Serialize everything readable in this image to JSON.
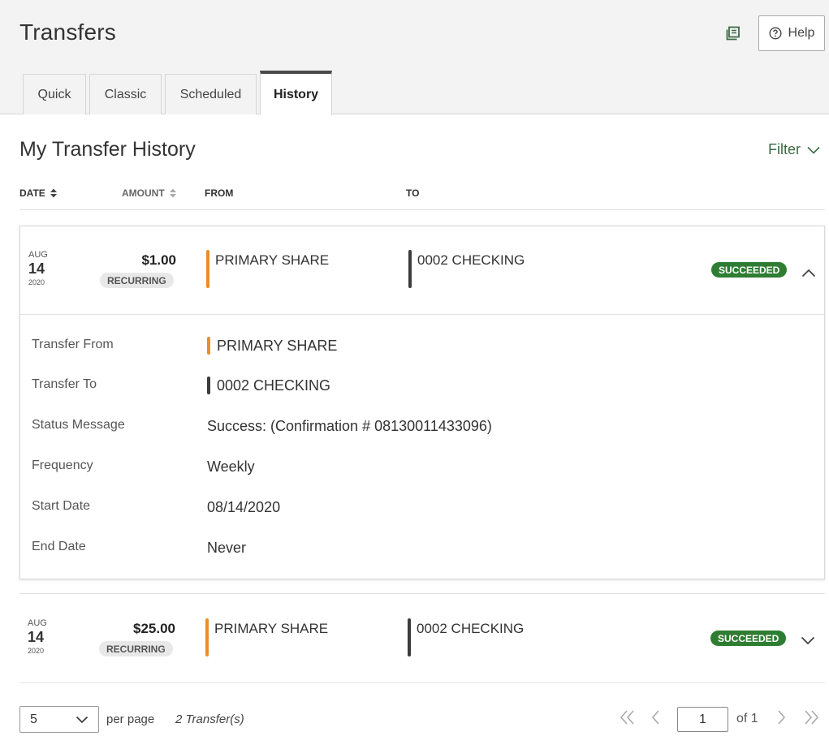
{
  "header": {
    "title": "Transfers",
    "help_label": "Help"
  },
  "tabs": [
    {
      "label": "Quick"
    },
    {
      "label": "Classic"
    },
    {
      "label": "Scheduled"
    },
    {
      "label": "History",
      "active": true
    }
  ],
  "history": {
    "title": "My Transfer History",
    "filter_label": "Filter",
    "columns": {
      "date": "DATE",
      "amount": "AMOUNT",
      "from": "FROM",
      "to": "TO"
    }
  },
  "transfers": [
    {
      "month": "AUG",
      "day": "14",
      "year": "2020",
      "amount": "$1.00",
      "type_badge": "RECURRING",
      "from": "PRIMARY SHARE",
      "to": "0002 CHECKING",
      "status": "SUCCEEDED",
      "expanded": true,
      "details": {
        "transfer_from_label": "Transfer From",
        "transfer_from": "PRIMARY SHARE",
        "transfer_to_label": "Transfer To",
        "transfer_to": "0002 CHECKING",
        "status_message_label": "Status Message",
        "status_message": "Success: (Confirmation # 08130011433096)",
        "frequency_label": "Frequency",
        "frequency": "Weekly",
        "start_date_label": "Start Date",
        "start_date": "08/14/2020",
        "end_date_label": "End Date",
        "end_date": "Never"
      }
    },
    {
      "month": "AUG",
      "day": "14",
      "year": "2020",
      "amount": "$25.00",
      "type_badge": "RECURRING",
      "from": "PRIMARY SHARE",
      "to": "0002 CHECKING",
      "status": "SUCCEEDED",
      "expanded": false
    }
  ],
  "pagination": {
    "per_page_value": "5",
    "per_page_label": "per page",
    "count_label": "2 Transfer(s)",
    "current_page": "1",
    "of_label": "of 1"
  },
  "colors": {
    "accent_green": "#3d6b45",
    "status_green": "#2e7d32",
    "from_account_color": "#e88f2b",
    "to_account_color": "#3c3c3c"
  }
}
